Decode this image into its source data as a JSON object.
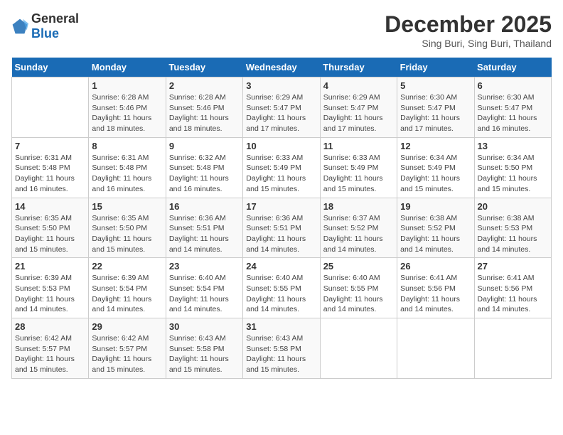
{
  "header": {
    "logo_general": "General",
    "logo_blue": "Blue",
    "title": "December 2025",
    "subtitle": "Sing Buri, Sing Buri, Thailand"
  },
  "weekdays": [
    "Sunday",
    "Monday",
    "Tuesday",
    "Wednesday",
    "Thursday",
    "Friday",
    "Saturday"
  ],
  "weeks": [
    [
      {
        "day": "",
        "sunrise": "",
        "sunset": "",
        "daylight": ""
      },
      {
        "day": "1",
        "sunrise": "6:28 AM",
        "sunset": "5:46 PM",
        "daylight": "11 hours and 18 minutes."
      },
      {
        "day": "2",
        "sunrise": "6:28 AM",
        "sunset": "5:46 PM",
        "daylight": "11 hours and 18 minutes."
      },
      {
        "day": "3",
        "sunrise": "6:29 AM",
        "sunset": "5:47 PM",
        "daylight": "11 hours and 17 minutes."
      },
      {
        "day": "4",
        "sunrise": "6:29 AM",
        "sunset": "5:47 PM",
        "daylight": "11 hours and 17 minutes."
      },
      {
        "day": "5",
        "sunrise": "6:30 AM",
        "sunset": "5:47 PM",
        "daylight": "11 hours and 17 minutes."
      },
      {
        "day": "6",
        "sunrise": "6:30 AM",
        "sunset": "5:47 PM",
        "daylight": "11 hours and 16 minutes."
      }
    ],
    [
      {
        "day": "7",
        "sunrise": "6:31 AM",
        "sunset": "5:48 PM",
        "daylight": "11 hours and 16 minutes."
      },
      {
        "day": "8",
        "sunrise": "6:31 AM",
        "sunset": "5:48 PM",
        "daylight": "11 hours and 16 minutes."
      },
      {
        "day": "9",
        "sunrise": "6:32 AM",
        "sunset": "5:48 PM",
        "daylight": "11 hours and 16 minutes."
      },
      {
        "day": "10",
        "sunrise": "6:33 AM",
        "sunset": "5:49 PM",
        "daylight": "11 hours and 15 minutes."
      },
      {
        "day": "11",
        "sunrise": "6:33 AM",
        "sunset": "5:49 PM",
        "daylight": "11 hours and 15 minutes."
      },
      {
        "day": "12",
        "sunrise": "6:34 AM",
        "sunset": "5:49 PM",
        "daylight": "11 hours and 15 minutes."
      },
      {
        "day": "13",
        "sunrise": "6:34 AM",
        "sunset": "5:50 PM",
        "daylight": "11 hours and 15 minutes."
      }
    ],
    [
      {
        "day": "14",
        "sunrise": "6:35 AM",
        "sunset": "5:50 PM",
        "daylight": "11 hours and 15 minutes."
      },
      {
        "day": "15",
        "sunrise": "6:35 AM",
        "sunset": "5:50 PM",
        "daylight": "11 hours and 15 minutes."
      },
      {
        "day": "16",
        "sunrise": "6:36 AM",
        "sunset": "5:51 PM",
        "daylight": "11 hours and 14 minutes."
      },
      {
        "day": "17",
        "sunrise": "6:36 AM",
        "sunset": "5:51 PM",
        "daylight": "11 hours and 14 minutes."
      },
      {
        "day": "18",
        "sunrise": "6:37 AM",
        "sunset": "5:52 PM",
        "daylight": "11 hours and 14 minutes."
      },
      {
        "day": "19",
        "sunrise": "6:38 AM",
        "sunset": "5:52 PM",
        "daylight": "11 hours and 14 minutes."
      },
      {
        "day": "20",
        "sunrise": "6:38 AM",
        "sunset": "5:53 PM",
        "daylight": "11 hours and 14 minutes."
      }
    ],
    [
      {
        "day": "21",
        "sunrise": "6:39 AM",
        "sunset": "5:53 PM",
        "daylight": "11 hours and 14 minutes."
      },
      {
        "day": "22",
        "sunrise": "6:39 AM",
        "sunset": "5:54 PM",
        "daylight": "11 hours and 14 minutes."
      },
      {
        "day": "23",
        "sunrise": "6:40 AM",
        "sunset": "5:54 PM",
        "daylight": "11 hours and 14 minutes."
      },
      {
        "day": "24",
        "sunrise": "6:40 AM",
        "sunset": "5:55 PM",
        "daylight": "11 hours and 14 minutes."
      },
      {
        "day": "25",
        "sunrise": "6:40 AM",
        "sunset": "5:55 PM",
        "daylight": "11 hours and 14 minutes."
      },
      {
        "day": "26",
        "sunrise": "6:41 AM",
        "sunset": "5:56 PM",
        "daylight": "11 hours and 14 minutes."
      },
      {
        "day": "27",
        "sunrise": "6:41 AM",
        "sunset": "5:56 PM",
        "daylight": "11 hours and 14 minutes."
      }
    ],
    [
      {
        "day": "28",
        "sunrise": "6:42 AM",
        "sunset": "5:57 PM",
        "daylight": "11 hours and 15 minutes."
      },
      {
        "day": "29",
        "sunrise": "6:42 AM",
        "sunset": "5:57 PM",
        "daylight": "11 hours and 15 minutes."
      },
      {
        "day": "30",
        "sunrise": "6:43 AM",
        "sunset": "5:58 PM",
        "daylight": "11 hours and 15 minutes."
      },
      {
        "day": "31",
        "sunrise": "6:43 AM",
        "sunset": "5:58 PM",
        "daylight": "11 hours and 15 minutes."
      },
      {
        "day": "",
        "sunrise": "",
        "sunset": "",
        "daylight": ""
      },
      {
        "day": "",
        "sunrise": "",
        "sunset": "",
        "daylight": ""
      },
      {
        "day": "",
        "sunrise": "",
        "sunset": "",
        "daylight": ""
      }
    ]
  ]
}
